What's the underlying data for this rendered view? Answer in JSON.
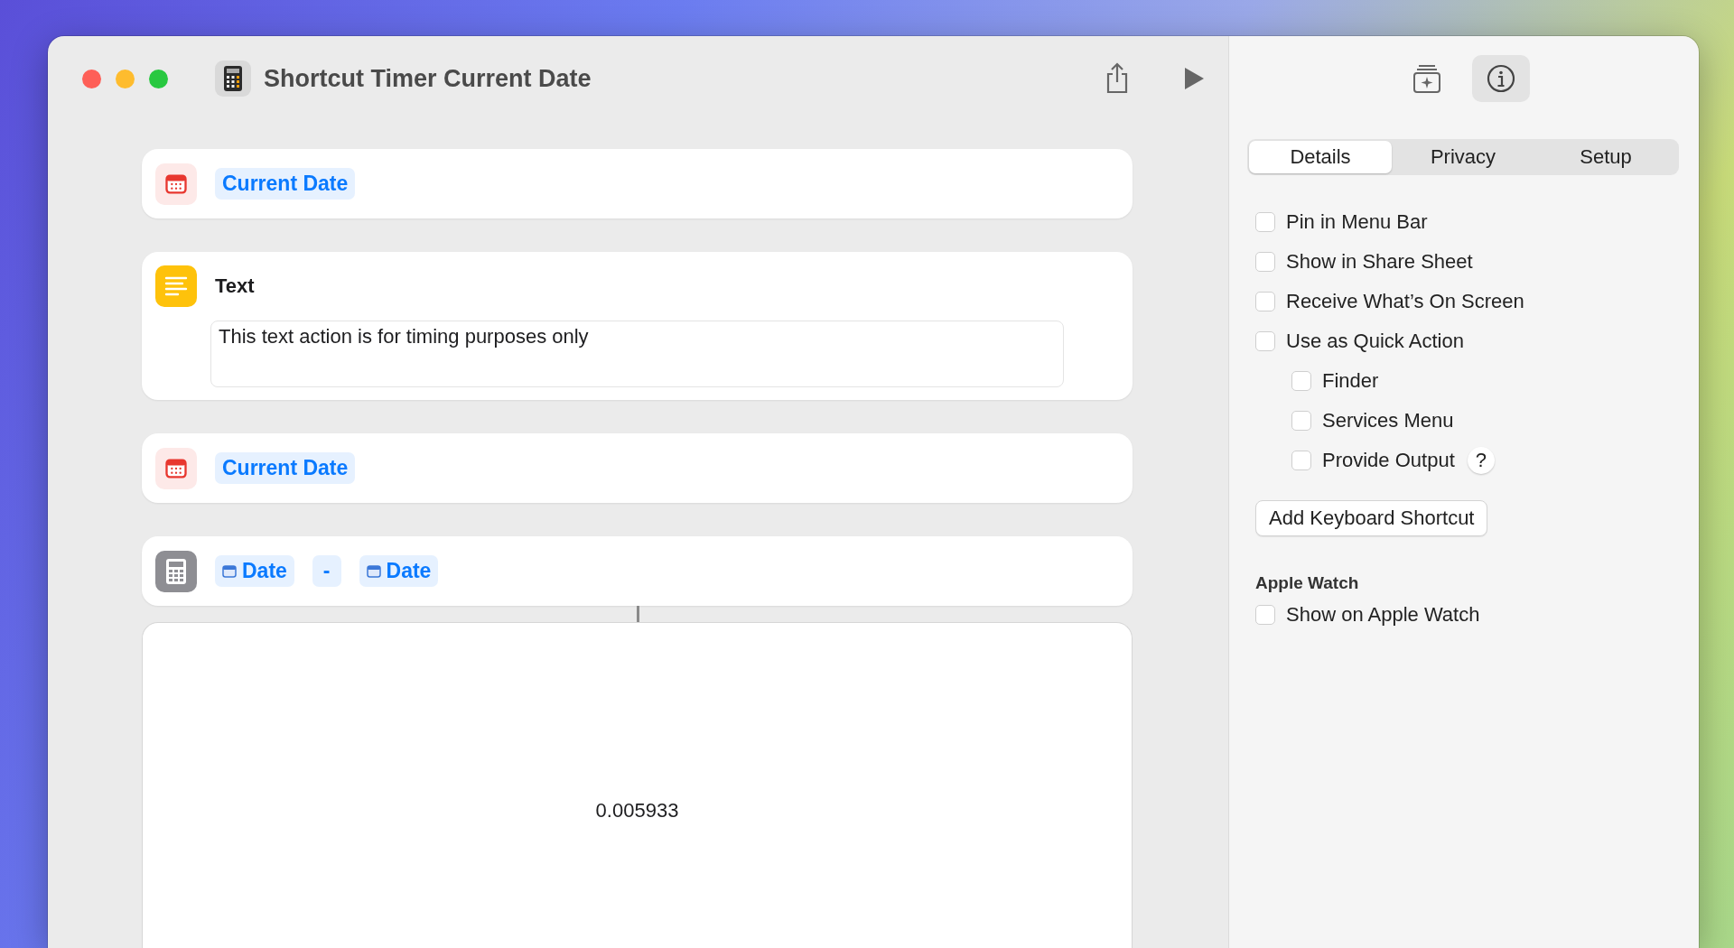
{
  "window": {
    "title": "Shortcut Timer Current Date"
  },
  "actions": [
    {
      "kind": "date",
      "token": "Current Date"
    },
    {
      "kind": "text",
      "title": "Text",
      "value": "This text action is for timing purposes only"
    },
    {
      "kind": "date",
      "token": "Current Date"
    },
    {
      "kind": "calc",
      "operand_1": "Date",
      "operator": "-",
      "operand_2": "Date"
    }
  ],
  "result": "0.005933",
  "inspector": {
    "toolbar": [
      {
        "kind": "add",
        "selected": false
      },
      {
        "kind": "info",
        "selected": true
      }
    ],
    "tabs": [
      {
        "label": "Details",
        "selected": true
      },
      {
        "label": "Privacy",
        "selected": false
      },
      {
        "label": "Setup",
        "selected": false
      }
    ],
    "options": [
      {
        "label": "Pin in Menu Bar",
        "checked": false
      },
      {
        "label": "Show in Share Sheet",
        "checked": false
      },
      {
        "label": "Receive What’s On Screen",
        "checked": false
      },
      {
        "label": "Use as Quick Action",
        "checked": false,
        "children": [
          {
            "label": "Finder",
            "checked": false
          },
          {
            "label": "Services Menu",
            "checked": false
          },
          {
            "label": "Provide Output",
            "checked": false,
            "help": "?"
          }
        ]
      }
    ],
    "button": "Add Keyboard Shortcut",
    "section": {
      "title": "Apple Watch",
      "options": [
        {
          "label": "Show on Apple Watch",
          "checked": false
        }
      ]
    }
  }
}
